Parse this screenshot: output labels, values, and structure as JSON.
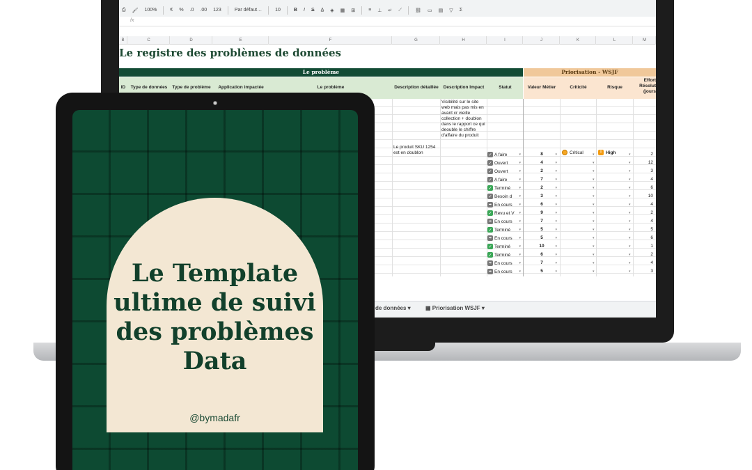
{
  "toolbar": {
    "zoom": "100%",
    "currency": "€",
    "percent": "%",
    "dec_decrease": ".0",
    "dec_increase": ".00",
    "number_format": "123",
    "font": "Par défaut…",
    "font_size": "10",
    "bold": "B",
    "italic": "I",
    "strike": "S"
  },
  "formula_bar": {
    "fx_label": "fx"
  },
  "columns": [
    "B",
    "C",
    "D",
    "E",
    "F",
    "G",
    "H",
    "I",
    "J",
    "K",
    "L",
    "M"
  ],
  "sheet": {
    "title": "Le registre des problèmes de données",
    "group_problem": "Le problème",
    "group_priority": "Priorisation - WSJF",
    "headers": {
      "id": "ID",
      "data_type": "Type de données",
      "problem_type": "Type de problème",
      "app": "Application impactée",
      "problem": "Le problème",
      "detail": "Description détaillée",
      "impact": "Description Impact",
      "status": "Statut",
      "business_value": "Valeur Métier",
      "criticity": "Criticité",
      "risk": "Risque",
      "effort": "Effort Résolut (jours"
    },
    "first_row": {
      "detail": "Le produit SKU 1254 est en doublon",
      "impact": "Visibilité sur le site web mais pas mis en avant cr vieille collection + doublon dans le rapport ce qui deouble le chiffre d'affaire du produit",
      "criticity": "Critical",
      "risk": "High"
    },
    "rows": [
      {
        "status": "A faire",
        "state": "open",
        "value": "8",
        "effort": "2"
      },
      {
        "status": "Ouvert",
        "state": "open",
        "value": "4",
        "effort": "12"
      },
      {
        "status": "Ouvert",
        "state": "open",
        "value": "2",
        "effort": "3"
      },
      {
        "status": "A faire",
        "state": "open",
        "value": "7",
        "effort": "4"
      },
      {
        "status": "Terminé",
        "state": "done",
        "value": "2",
        "effort": "6"
      },
      {
        "status": "Besoin d",
        "state": "open",
        "value": "3",
        "effort": "10"
      },
      {
        "status": "En cours",
        "state": "prog",
        "value": "6",
        "effort": "4"
      },
      {
        "status": "Revu et V",
        "state": "done",
        "value": "9",
        "effort": "2"
      },
      {
        "status": "En cours",
        "state": "prog",
        "value": "7",
        "effort": "4"
      },
      {
        "status": "Terminé",
        "state": "done",
        "value": "5",
        "effort": "5"
      },
      {
        "status": "En cours",
        "state": "prog",
        "value": "5",
        "effort": "6"
      },
      {
        "status": "Terminé",
        "state": "done",
        "value": "10",
        "effort": "1"
      },
      {
        "status": "Terminé",
        "state": "done",
        "value": "6",
        "effort": "2"
      },
      {
        "status": "En cours",
        "state": "prog",
        "value": "7",
        "effort": "4"
      },
      {
        "status": "En cours",
        "state": "prog",
        "value": "5",
        "effort": "3"
      }
    ]
  },
  "tabs": [
    {
      "label": "de données"
    },
    {
      "label": "Priorisation WSJF"
    }
  ],
  "cover": {
    "title_line1": "Le Template",
    "title_line2": "ultime de suivi",
    "title_line3": "des problèmes",
    "title_line4": "Data",
    "handle": "@bymadafr"
  },
  "colors": {
    "brand_green": "#124b34",
    "cover_cream": "#f3e7d3",
    "priority_orange": "#f0c89a"
  }
}
